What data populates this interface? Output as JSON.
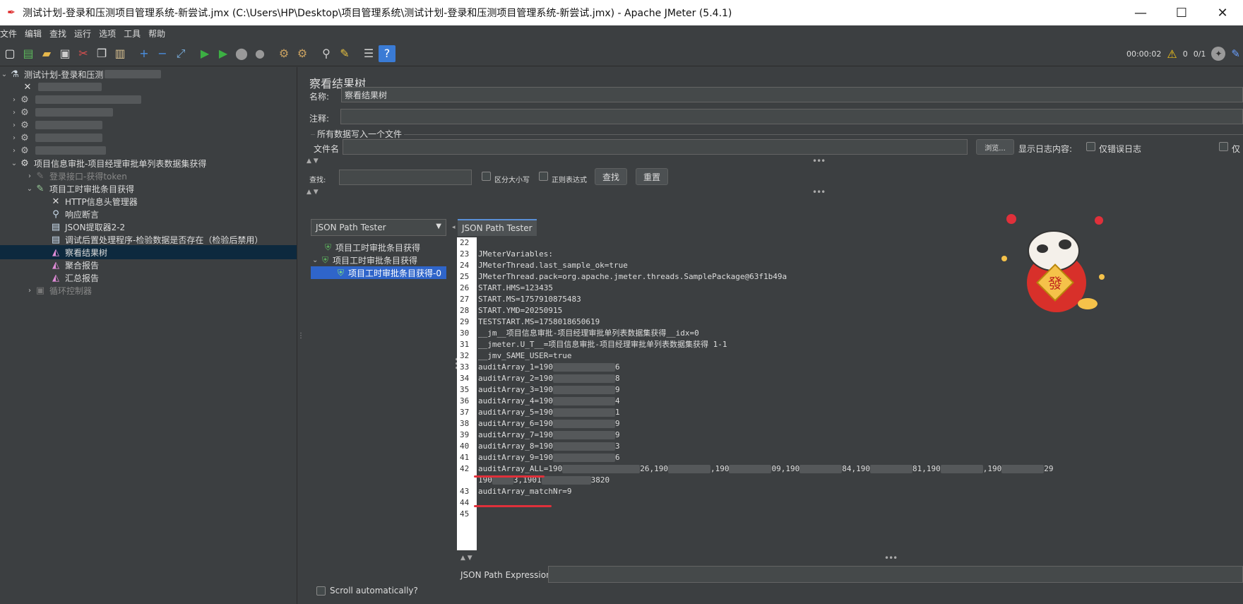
{
  "window": {
    "title": "测试计划-登录和压测项目管理系统-新尝试.jmx (C:\\Users\\HP\\Desktop\\项目管理系统\\测试计划-登录和压测项目管理系统-新尝试.jmx) - Apache JMeter (5.4.1)",
    "minimize": "—",
    "maximize": "☐",
    "close": "✕"
  },
  "menu": [
    "文件",
    "编辑",
    "查找",
    "运行",
    "选项",
    "工具",
    "帮助"
  ],
  "toolbar_status": {
    "elapsed": "00:00:02",
    "warnings": "0",
    "threads": "0/1"
  },
  "tree": {
    "root_label": "测试计划-登录和压测",
    "thread_group": "项目信息审批-项目经理审批单列表数据集获得",
    "login_sampler": "登录接口-获得token",
    "sampler": "项目工时审批条目获得",
    "children": [
      {
        "label": "HTTP信息头管理器"
      },
      {
        "label": "响应断言"
      },
      {
        "label": "JSON提取器2-2"
      },
      {
        "label": "调试后置处理程序-检验数据是否存在（检验后禁用）"
      },
      {
        "label": "察看结果树"
      },
      {
        "label": "聚合报告"
      },
      {
        "label": "汇总报告"
      }
    ],
    "loop_controller": "循环控制器"
  },
  "panel": {
    "title": "察看结果树",
    "name_label": "名称:",
    "name_value": "察看结果树",
    "comment_label": "注释:",
    "comment_value": "",
    "group_label": "所有数据写入一个文件",
    "filename_label": "文件名",
    "browse_button": "浏览...",
    "log_content_label": "显示日志内容:",
    "errors_only_label": "仅错误日志",
    "success_only_label": "仅",
    "search_label": "查找:",
    "case_sensitive_label": "区分大小写",
    "regex_label": "正则表达式",
    "find_button": "查找",
    "reset_button": "重置"
  },
  "results": {
    "renderer": "JSON Path Tester",
    "items": [
      {
        "label": "项目工时审批条目获得"
      },
      {
        "label": "项目工时审批条目获得"
      },
      {
        "label": "项目工时审批条目获得-0"
      }
    ],
    "tab_label": "JSON Path Tester",
    "scroll_auto_label": "Scroll automatically?",
    "expression_label": "JSON Path Expression",
    "expression_value": ""
  },
  "code_lines": [
    {
      "n": "22",
      "text": ""
    },
    {
      "n": "23",
      "text": "JMeterVariables:"
    },
    {
      "n": "24",
      "text": "JMeterThread.last_sample_ok=true"
    },
    {
      "n": "25",
      "text": "JMeterThread.pack=org.apache.jmeter.threads.SamplePackage@63f1b49a"
    },
    {
      "n": "26",
      "text": "START.HMS=123435"
    },
    {
      "n": "27",
      "text": "START.MS=1757910875483"
    },
    {
      "n": "28",
      "text": "START.YMD=20250915"
    },
    {
      "n": "29",
      "text": "TESTSTART.MS=1758018650619"
    },
    {
      "n": "30",
      "text": "__jm__项目信息审批-项目经理审批单列表数据集获得__idx=0"
    },
    {
      "n": "31",
      "text": "__jmeter.U_T__=项目信息审批-项目经理审批单列表数据集获得 1-1"
    },
    {
      "n": "32",
      "text": "__jmv_SAME_USER=true"
    },
    {
      "n": "33",
      "text": "auditArray_1=190",
      "tail": "6"
    },
    {
      "n": "34",
      "text": "auditArray_2=190",
      "tail": "8"
    },
    {
      "n": "35",
      "text": "auditArray_3=190",
      "tail": "9"
    },
    {
      "n": "36",
      "text": "auditArray_4=190",
      "tail": "4"
    },
    {
      "n": "37",
      "text": "auditArray_5=190",
      "tail": "1"
    },
    {
      "n": "38",
      "text": "auditArray_6=190",
      "tail": "9"
    },
    {
      "n": "39",
      "text": "auditArray_7=190",
      "tail": "9"
    },
    {
      "n": "40",
      "text": "auditArray_8=190",
      "tail": "3"
    },
    {
      "n": "41",
      "text": "auditArray_9=190",
      "tail": "6"
    },
    {
      "n": "42",
      "text": "auditArray_ALL=190",
      "tail": "26,190"
    },
    {
      "n": "",
      "text": "190",
      "tail": "3,1901",
      "tail2": "3820"
    },
    {
      "n": "43",
      "text": "auditArray_matchNr=9"
    },
    {
      "n": "44",
      "text": ""
    },
    {
      "n": "45",
      "text": ""
    }
  ],
  "line42_segments": [
    ",190",
    "09,190",
    "84,190",
    "81,190",
    ",190",
    "29"
  ]
}
